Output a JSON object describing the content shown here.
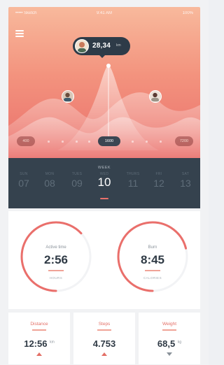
{
  "status_bar": {
    "carrier": "••••• Sketch",
    "time": "9:41 AM",
    "battery": "100%"
  },
  "header": {
    "menu_icon": "hamburger-icon"
  },
  "tooltip": {
    "value": "28,34",
    "unit": "km"
  },
  "range": {
    "start": "400",
    "current": "1600",
    "end": "7200"
  },
  "week": {
    "title": "WEEK",
    "selected_index": 3,
    "days": [
      {
        "name": "SUN",
        "date": "07"
      },
      {
        "name": "MON",
        "date": "08"
      },
      {
        "name": "TUES",
        "date": "09"
      },
      {
        "name": "WED",
        "date": "10"
      },
      {
        "name": "THURS",
        "date": "11"
      },
      {
        "name": "FRI",
        "date": "12"
      },
      {
        "name": "SAT",
        "date": "13"
      }
    ]
  },
  "rings": [
    {
      "label": "Active time",
      "value": "2:56",
      "unit": "HOURS",
      "progress": 0.63
    },
    {
      "label": "Burn",
      "value": "8:45",
      "unit": "CALORIES",
      "progress": 0.71
    }
  ],
  "stats": [
    {
      "label": "Distance",
      "value": "12:56",
      "unit": "km",
      "trend": "up"
    },
    {
      "label": "Steps",
      "value": "4.753",
      "unit": "",
      "trend": "up"
    },
    {
      "label": "Weight",
      "value": "68,5",
      "unit": "kg",
      "trend": "down"
    }
  ],
  "colors": {
    "accent": "#ea6f6b",
    "dark": "#35424e",
    "ring_track": "#f2f3f5"
  }
}
